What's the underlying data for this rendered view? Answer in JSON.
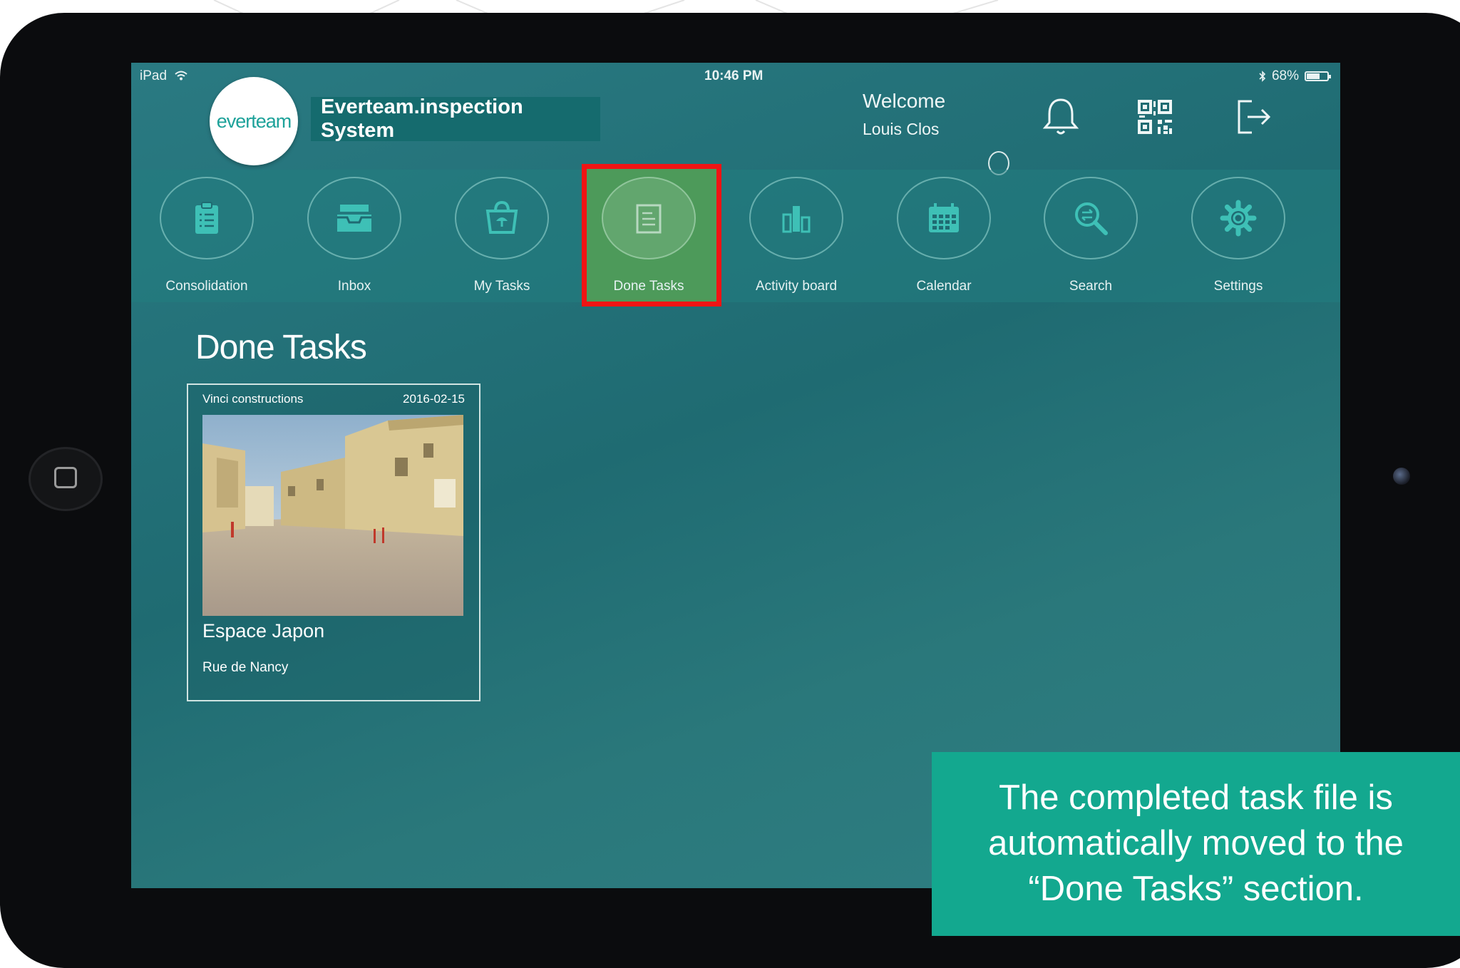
{
  "status_bar": {
    "device": "iPad",
    "time": "10:46 PM",
    "battery": "68%",
    "battery_level": 0.68
  },
  "header": {
    "logo_text": "everteam",
    "app_title": "Everteam.inspection System",
    "welcome": "Welcome",
    "user_name": "Louis Clos"
  },
  "icons": {
    "bell": "bell-icon",
    "qr": "qr-code-icon",
    "logout": "logout-icon"
  },
  "nav": {
    "items": [
      {
        "label": "Consolidation",
        "icon": "clipboard-icon"
      },
      {
        "label": "Inbox",
        "icon": "inbox-tray-icon"
      },
      {
        "label": "My Tasks",
        "icon": "basket-icon"
      },
      {
        "label": "Done Tasks",
        "icon": "document-icon",
        "active": true
      },
      {
        "label": "Activity board",
        "icon": "bar-chart-icon"
      },
      {
        "label": "Calendar",
        "icon": "calendar-icon"
      },
      {
        "label": "Search",
        "icon": "search-icon"
      },
      {
        "label": "Settings",
        "icon": "gear-icon"
      }
    ]
  },
  "main": {
    "section_title": "Done Tasks",
    "task": {
      "company": "Vinci constructions",
      "date": "2016-02-15",
      "name": "Espace Japon",
      "address": "Rue de Nancy"
    }
  },
  "caption": {
    "text": "The completed task file is automatically moved to the “Done Tasks” section."
  },
  "colors": {
    "screen": "#1f6b72",
    "highlight_border": "#f01414",
    "caption_bg": "#13a88f",
    "logo_teal": "#1ea29a"
  }
}
